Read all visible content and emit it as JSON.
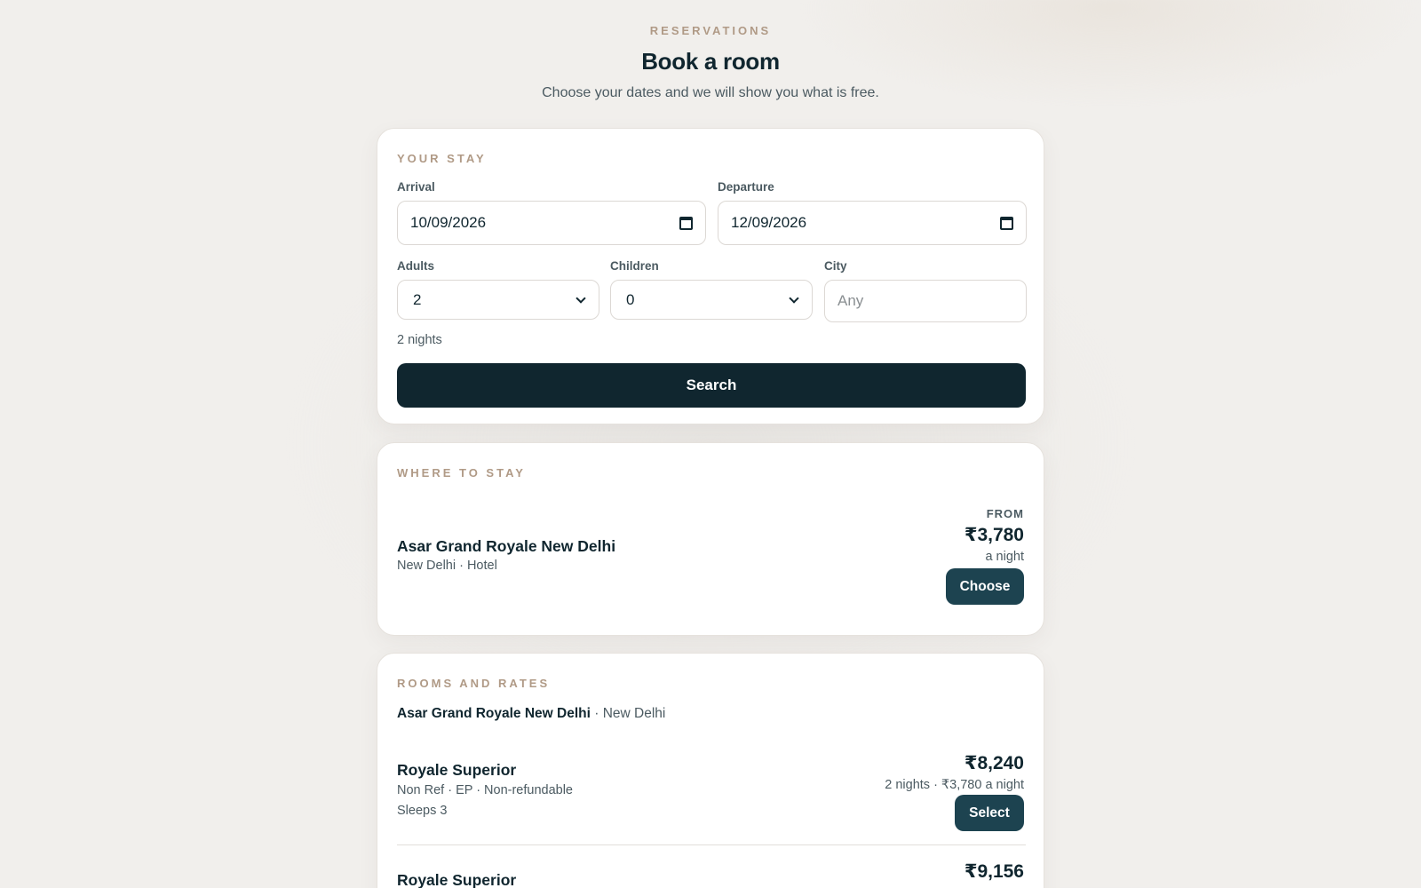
{
  "header": {
    "eyebrow": "RESERVATIONS",
    "title": "Book a room",
    "subtitle": "Choose your dates and we will show you what is free."
  },
  "stay": {
    "section_label": "YOUR STAY",
    "arrival": {
      "label": "Arrival",
      "value": "10/09/2026"
    },
    "departure": {
      "label": "Departure",
      "value": "12/09/2026"
    },
    "adults": {
      "label": "Adults",
      "value": "2"
    },
    "children": {
      "label": "Children",
      "value": "0"
    },
    "city": {
      "label": "City",
      "placeholder": "Any"
    },
    "nights": "2 nights",
    "search_label": "Search"
  },
  "where": {
    "section_label": "WHERE TO STAY",
    "hotel_name": "Asar Grand Royale New Delhi",
    "hotel_meta": "New Delhi · Hotel",
    "from_label": "FROM",
    "from_price": "₹3,780",
    "from_sub": "a night",
    "choose_label": "Choose"
  },
  "rooms": {
    "section_label": "ROOMS AND RATES",
    "hotel_name": "Asar Grand Royale New Delhi",
    "hotel_city": " · New Delhi",
    "items": [
      {
        "name": "Royale Superior",
        "meta": "Non Ref · EP · Non-refundable",
        "sleeps": "Sleeps 3",
        "price": "₹8,240",
        "sub": "2 nights · ₹3,780 a night",
        "select_label": "Select"
      },
      {
        "name": "Royale Superior",
        "price": "₹9,156"
      }
    ]
  },
  "colors": {
    "primary": "#10262f",
    "button": "#1d4350",
    "eyebrow": "#b09a86",
    "background": "#f1efec"
  }
}
